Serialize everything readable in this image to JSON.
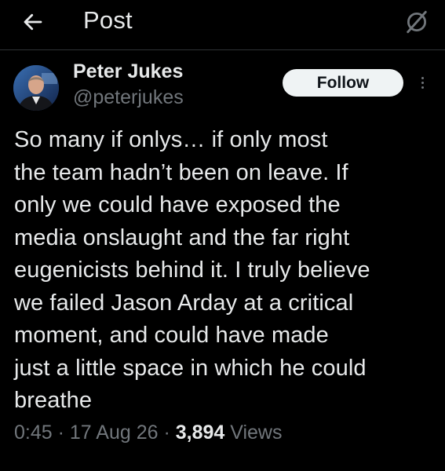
{
  "header": {
    "title": "Post",
    "back_icon": "arrow-left-icon",
    "action_icon": "grok-icon"
  },
  "post": {
    "author": {
      "name": "Peter Jukes",
      "handle": "@peterjukes"
    },
    "follow_label": "Follow",
    "more_icon": "more-vertical-icon",
    "text": "So many if onlys… if only most\nthe team hadn’t been on leave. If\nonly we could have exposed the\nmedia onslaught and the far right\neugenicists behind it. I truly believe\nwe failed Jason Arday at a critical\nmoment, and could have made\njust a little space in which he could\nbreathe",
    "time": "0:45",
    "separator": " · ",
    "date": "17 Aug 26",
    "views_count": "3,894",
    "views_label": "Views"
  },
  "colors": {
    "background": "#000000",
    "text_primary": "#e7e9ea",
    "text_secondary": "#71767b",
    "divider": "#2f3336",
    "follow_bg": "#eff3f4",
    "follow_text": "#0f1419"
  }
}
